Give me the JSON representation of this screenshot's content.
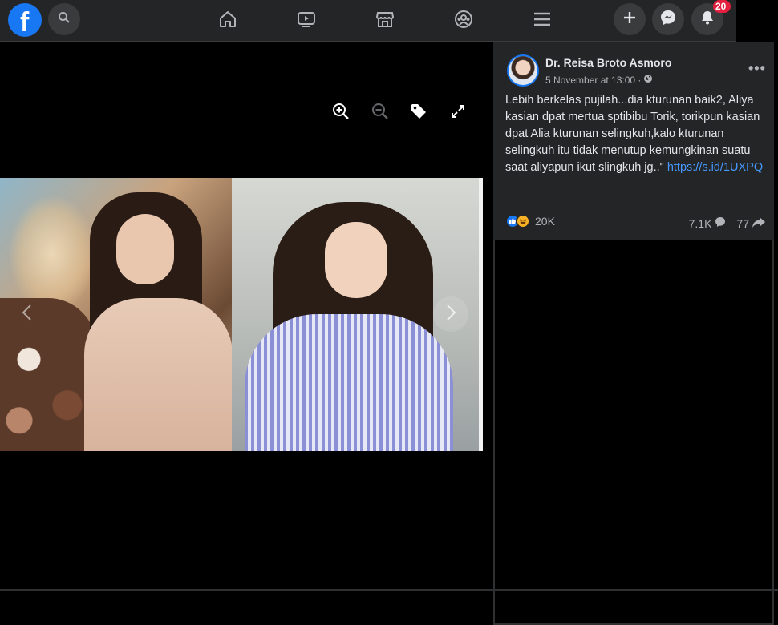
{
  "topbar": {
    "icons": {
      "logo": "facebook-logo",
      "search": "search-icon",
      "home": "home-icon",
      "watch": "video-icon",
      "marketplace": "store-icon",
      "groups": "groups-icon",
      "menu": "hamburger-icon",
      "create": "plus-icon",
      "messenger": "messenger-icon",
      "notifications": "bell-icon"
    },
    "notification_count": "20"
  },
  "viewer": {
    "tools": [
      "zoom-in-icon",
      "zoom-out-icon",
      "tag-icon",
      "fullscreen-icon"
    ]
  },
  "post": {
    "author": "Dr. Reisa Broto Asmoro",
    "date": "5 November at 13:00 ·",
    "text": "Lebih berkelas pujilah...dia kturunan baik2, Aliya kasian dpat mertua sptibibu Torik, torikpun kasian dpat Alia kturunan selingkuh,kalo kturunan selingkuh itu tidak menutup kemungkinan suatu saat aliyapun ikut slingkuh jg..\"",
    "link": "https://s.id/1UXPQ",
    "reactions_count": "20K",
    "comments_count": "7.1K",
    "shares_count": "77"
  },
  "colors": {
    "accent": "#1877f2",
    "link": "#4599ff",
    "badge": "#e41e3f",
    "surface": "#242526"
  }
}
